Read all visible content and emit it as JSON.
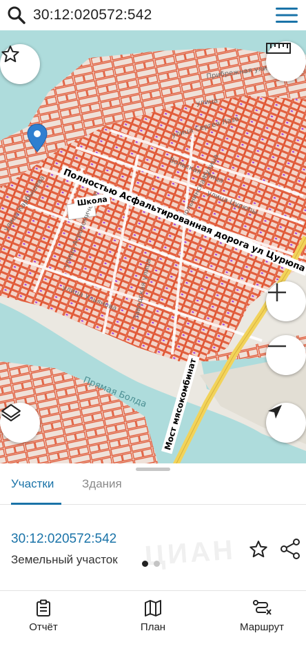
{
  "search": {
    "query": "30:12:020572:542"
  },
  "map": {
    "labels": {
      "road_note": "Полностью  Асфальтированная дорога  ул Цурюпа",
      "school": "Школа",
      "bridge": "Мост мясокомбинат",
      "river": "Прямая Болда",
      "street_1": "улица Карбышева",
      "street_2": "улица",
      "street_3": "улица Сергея Лазо",
      "street_4": "Вольская улица",
      "street_5": "улица Цурюпы",
      "street_6": "Смольнинская улица",
      "street_7": "улица Ульянова",
      "street_8": "Заводская улица",
      "street_9": "улица Агрономическая",
      "street_10": "Прибрежная улица"
    },
    "colors": {
      "parcel": "#e0522f",
      "water": "#aedcdc",
      "land": "#e9e6df",
      "building_marker": "#a040e0",
      "road": "#f2d35a",
      "pin": "#2f7fd0"
    }
  },
  "sheet": {
    "tabs": [
      {
        "label": "Участки",
        "active": true
      },
      {
        "label": "Здания",
        "active": false
      }
    ],
    "parcel": {
      "number": "30:12:020572:542",
      "type": "Земельный участок"
    },
    "pager": {
      "current": 1,
      "total": 2
    },
    "watermark": "ЦИАН"
  },
  "bottom_nav": [
    {
      "label": "Отчёт",
      "icon": "clipboard-icon"
    },
    {
      "label": "План",
      "icon": "map-icon"
    },
    {
      "label": "Маршрут",
      "icon": "route-icon"
    }
  ],
  "accent": "#1a73a8"
}
